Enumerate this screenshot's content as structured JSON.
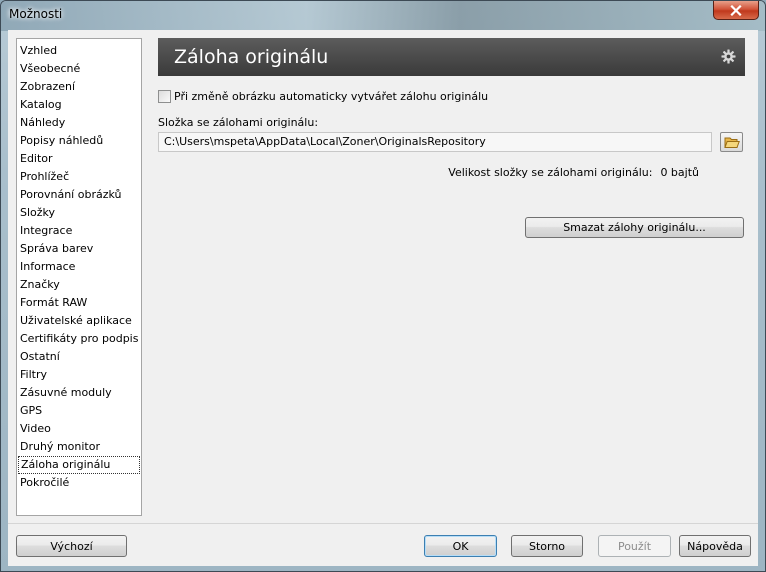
{
  "window": {
    "title": "Možnosti"
  },
  "sidebar": {
    "items": [
      "Vzhled",
      "Všeobecné",
      "Zobrazení",
      "Katalog",
      "Náhledy",
      "Popisy náhledů",
      "Editor",
      "Prohlížeč",
      "Porovnání obrázků",
      "Složky",
      "Integrace",
      "Správa barev",
      "Informace",
      "Značky",
      "Formát RAW",
      "Uživatelské aplikace",
      "Certifikáty pro podpis",
      "Ostatní",
      "Filtry",
      "Zásuvné moduly",
      "GPS",
      "Video",
      "Druhý monitor",
      "Záloha originálu",
      "Pokročilé"
    ],
    "selected": "Záloha originálu"
  },
  "header": {
    "title": "Záloha originálu",
    "icon": "gear-icon"
  },
  "content": {
    "auto_backup_label": "Při změně obrázku automaticky vytvářet zálohu originálu",
    "auto_backup_checked": false,
    "folder_label": "Složka se zálohami originálu:",
    "folder_path": "C:\\Users\\mspeta\\AppData\\Local\\Zoner\\OriginalsRepository",
    "size_label": "Velikost složky se zálohami originálu:",
    "size_value": "0 bajtů",
    "delete_button": "Smazat zálohy originálu..."
  },
  "footer": {
    "default_button": "Výchozí",
    "ok_button": "OK",
    "cancel_button": "Storno",
    "apply_button": "Použít",
    "help_button": "Nápověda"
  },
  "colors": {
    "header_bg": "#3a3a3a",
    "close_button": "#c0391d"
  }
}
